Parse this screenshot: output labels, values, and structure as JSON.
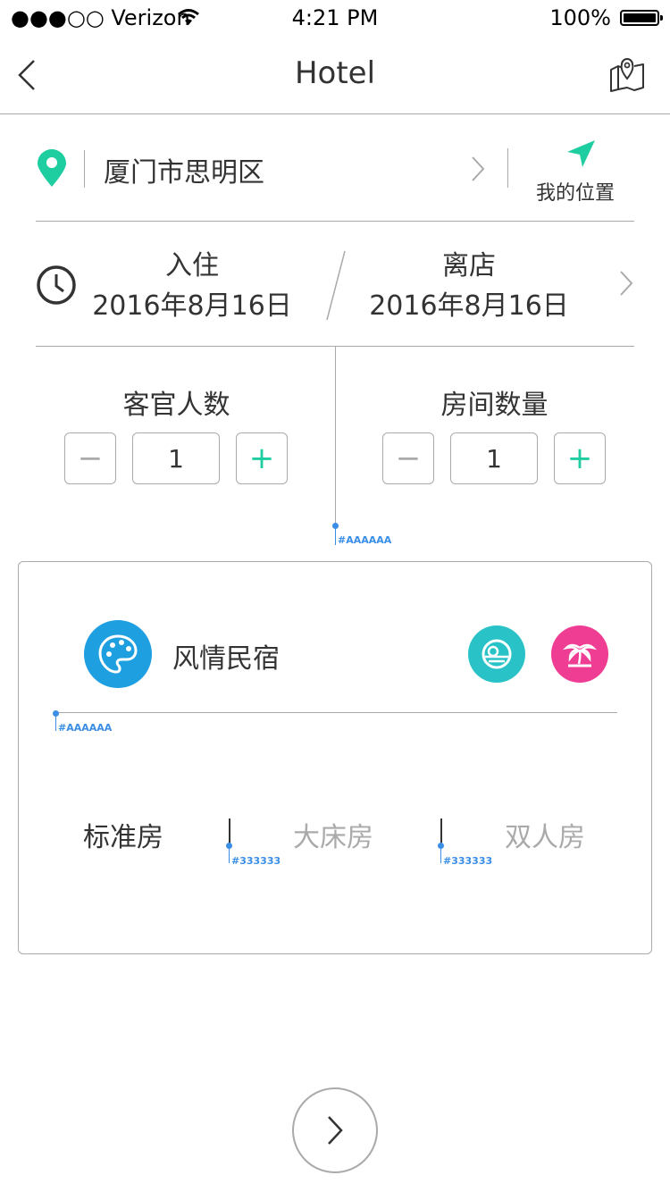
{
  "status_bar": {
    "carrier": "●●●○○ Verizon",
    "time": "4:21 PM",
    "battery": "100%"
  },
  "nav": {
    "title": "Hotel",
    "back_icon": "chevron-left-icon",
    "map_icon": "map-pin-icon"
  },
  "location": {
    "city": "厦门市思明区",
    "my_location_label": "我的位置"
  },
  "dates": {
    "checkin_label": "入住",
    "checkin_date": "2016年8月16日",
    "checkout_label": "离店",
    "checkout_date": "2016年8月16日"
  },
  "guests": {
    "label": "客官人数",
    "value": "1",
    "minus": "−",
    "plus": "+"
  },
  "rooms": {
    "label": "房间数量",
    "value": "1",
    "minus": "−",
    "plus": "+"
  },
  "annotations": {
    "a1": "#AAAAAA",
    "a2": "#AAAAAA",
    "a3": "#333333",
    "a4": "#333333"
  },
  "category": {
    "title": "风情民宿"
  },
  "room_types": [
    {
      "label": "标准房",
      "selected": true
    },
    {
      "label": "大床房",
      "selected": false
    },
    {
      "label": "双人房",
      "selected": false
    }
  ],
  "colors": {
    "accent": "#1ecda0",
    "blue": "#1e9fe0",
    "teal": "#29c2c6",
    "pink": "#ee3d93",
    "divider": "#aaaaaa",
    "text": "#333333"
  }
}
